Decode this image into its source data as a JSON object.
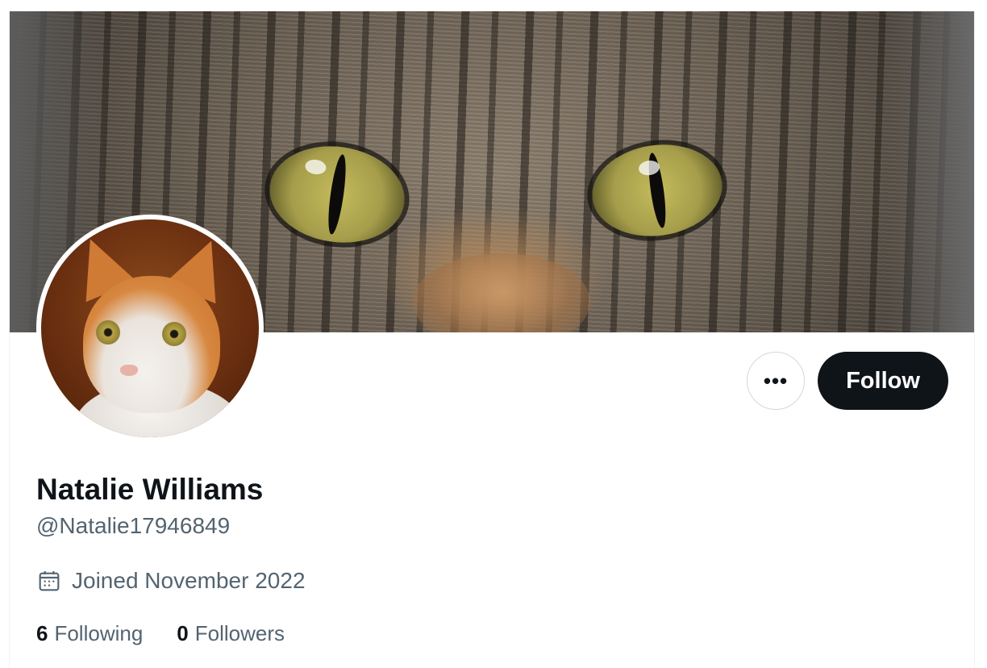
{
  "profile": {
    "display_name": "Natalie Williams",
    "handle": "@Natalie17946849",
    "joined": "Joined November 2022",
    "following_count": "6",
    "following_label": "Following",
    "followers_count": "0",
    "followers_label": "Followers"
  },
  "actions": {
    "more_label": "•••",
    "follow_label": "Follow"
  },
  "icons": {
    "more": "more-horizontal-icon",
    "joined": "calendar-icon"
  },
  "colors": {
    "primary_text": "#0f1419",
    "secondary_text": "#536471",
    "follow_button_bg": "#0f1419",
    "border": "#cfd9de"
  }
}
